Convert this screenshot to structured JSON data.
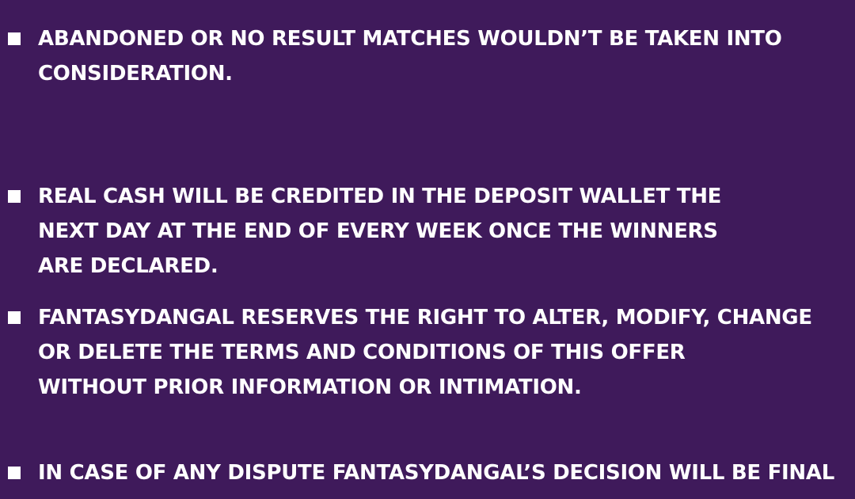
{
  "terms": [
    {
      "lines": [
        "ABANDONED OR NO RESULT MATCHES WOULDN’T BE TAKEN INTO",
        "CONSIDERATION."
      ]
    },
    {
      "lines": [
        "REAL CASH WILL BE CREDITED IN THE DEPOSIT WALLET THE",
        "NEXT DAY AT THE END OF EVERY WEEK ONCE THE WINNERS",
        "ARE DECLARED."
      ]
    },
    {
      "lines": [
        "FANTASYDANGAL RESERVES THE RIGHT TO ALTER, MODIFY, CHANGE",
        "OR DELETE THE TERMS AND CONDITIONS OF THIS OFFER",
        "WITHOUT PRIOR INFORMATION OR INTIMATION."
      ]
    },
    {
      "lines": [
        "IN CASE OF ANY DISPUTE FANTASYDANGAL’S DECISION WILL BE FINAL"
      ]
    }
  ],
  "colors": {
    "background": "#3f1a5b",
    "text": "#ffffff",
    "bullet": "#ffffff"
  }
}
